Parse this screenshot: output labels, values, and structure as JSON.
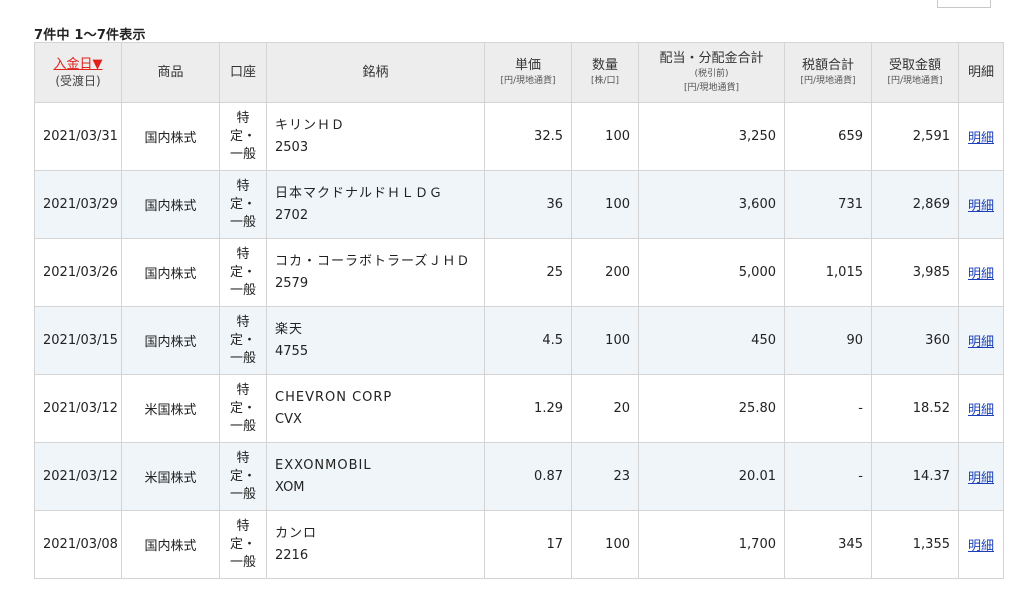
{
  "result_count_text": "7件中 1〜7件表示",
  "headers": {
    "date": "入金日▼",
    "date_sub": "(受渡日)",
    "product": "商品",
    "account": "口座",
    "brand": "銘柄",
    "price": "単価",
    "price_unit": "[円/現地通貨]",
    "qty": "数量",
    "qty_unit": "[株/口]",
    "total": "配当・分配金合計",
    "total_sub": "(税引前)",
    "total_unit": "[円/現地通貨]",
    "tax": "税額合計",
    "tax_unit": "[円/現地通貨]",
    "received": "受取金額",
    "received_unit": "[円/現地通貨]",
    "detail": "明細"
  },
  "rows": [
    {
      "date": "2021/03/31",
      "product": "国内株式",
      "acct1": "特",
      "acct2": "定・",
      "acct3": "一般",
      "name": "キリンＨＤ",
      "code": "2503",
      "price": "32.5",
      "qty": "100",
      "total": "3,250",
      "tax": "659",
      "received": "2,591",
      "detail": "明細"
    },
    {
      "date": "2021/03/29",
      "product": "国内株式",
      "acct1": "特",
      "acct2": "定・",
      "acct3": "一般",
      "name": "日本マクドナルドＨＬＤＧ",
      "code": "2702",
      "price": "36",
      "qty": "100",
      "total": "3,600",
      "tax": "731",
      "received": "2,869",
      "detail": "明細"
    },
    {
      "date": "2021/03/26",
      "product": "国内株式",
      "acct1": "特",
      "acct2": "定・",
      "acct3": "一般",
      "name": "コカ・コーラボトラーズＪＨＤ",
      "code": "2579",
      "price": "25",
      "qty": "200",
      "total": "5,000",
      "tax": "1,015",
      "received": "3,985",
      "detail": "明細"
    },
    {
      "date": "2021/03/15",
      "product": "国内株式",
      "acct1": "特",
      "acct2": "定・",
      "acct3": "一般",
      "name": "楽天",
      "code": "4755",
      "price": "4.5",
      "qty": "100",
      "total": "450",
      "tax": "90",
      "received": "360",
      "detail": "明細"
    },
    {
      "date": "2021/03/12",
      "product": "米国株式",
      "acct1": "特",
      "acct2": "定・",
      "acct3": "一般",
      "name": "CHEVRON CORP",
      "code": "CVX",
      "price": "1.29",
      "qty": "20",
      "total": "25.80",
      "tax": "-",
      "received": "18.52",
      "detail": "明細"
    },
    {
      "date": "2021/03/12",
      "product": "米国株式",
      "acct1": "特",
      "acct2": "定・",
      "acct3": "一般",
      "name": "EXXONMOBIL",
      "code": "XOM",
      "price": "0.87",
      "qty": "23",
      "total": "20.01",
      "tax": "-",
      "received": "14.37",
      "detail": "明細"
    },
    {
      "date": "2021/03/08",
      "product": "国内株式",
      "acct1": "特",
      "acct2": "定・",
      "acct3": "一般",
      "name": "カンロ",
      "code": "2216",
      "price": "17",
      "qty": "100",
      "total": "1,700",
      "tax": "345",
      "received": "1,355",
      "detail": "明細"
    }
  ]
}
